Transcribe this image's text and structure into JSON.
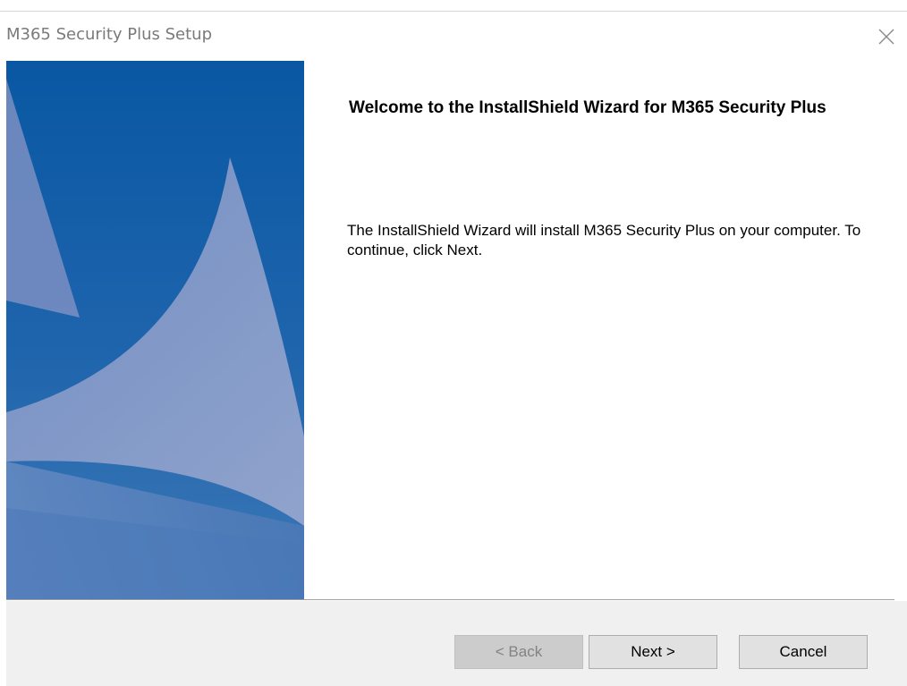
{
  "window": {
    "title": "M365 Security Plus Setup",
    "close_icon": "close-icon"
  },
  "banner": {
    "image": "installshield-blue-sail-banner",
    "colors": {
      "dark_blue": "#0b5aa6",
      "mid_blue": "#3f79b6",
      "pale_shape": "#8f9fc9"
    }
  },
  "content": {
    "heading": "Welcome to the InstallShield Wizard for M365 Security Plus",
    "body": "The InstallShield Wizard will install M365 Security Plus on your computer.  To continue, click Next."
  },
  "buttons": {
    "back_label": "< Back",
    "next_label": "Next >",
    "cancel_label": "Cancel"
  }
}
